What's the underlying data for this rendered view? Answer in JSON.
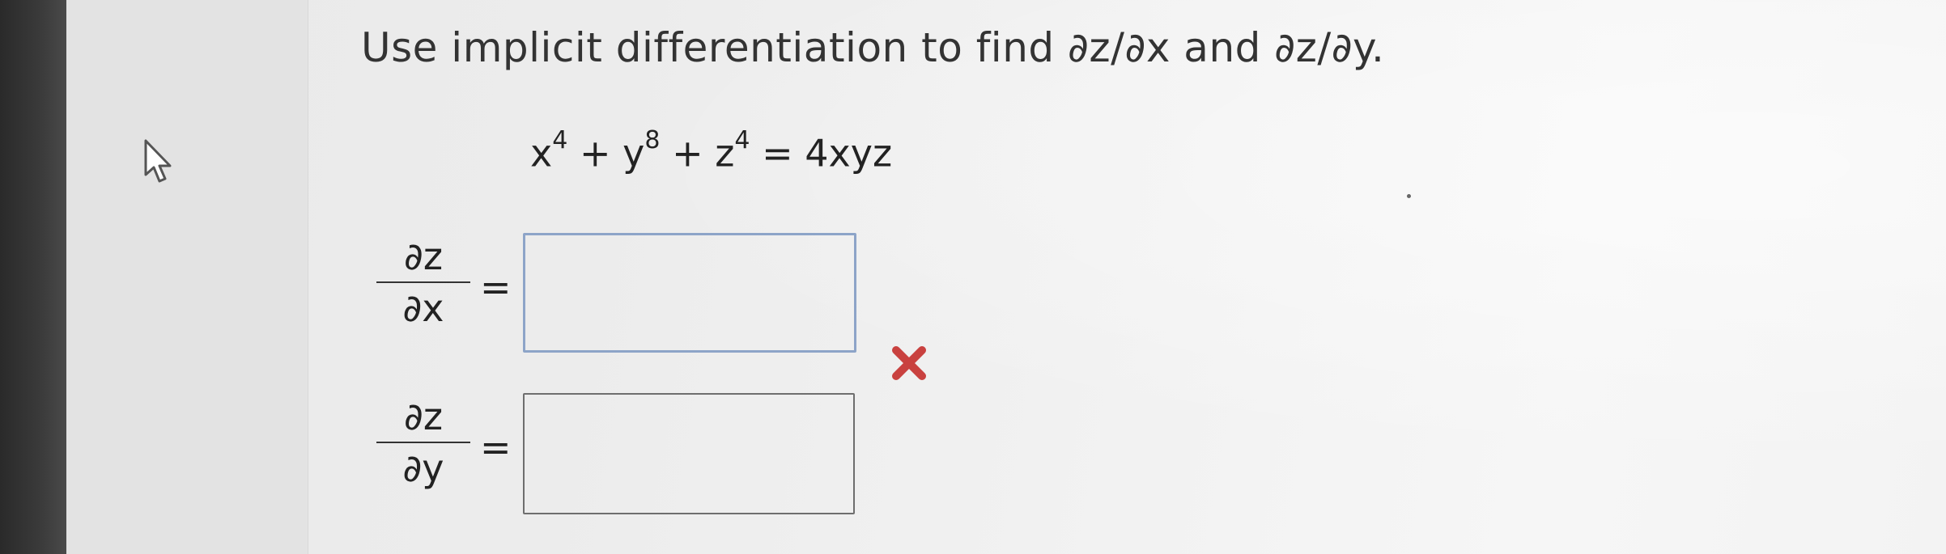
{
  "question": {
    "text": "Use implicit differentiation to find ∂z/∂x and ∂z/∂y."
  },
  "equation": {
    "base1": "x",
    "exp1": "4",
    "plus1": " + ",
    "base2": "y",
    "exp2": "8",
    "plus2": " + ",
    "base3": "z",
    "exp3": "4",
    "rhs": " = 4xyz"
  },
  "answers": [
    {
      "numerator": "∂z",
      "denominator": "∂x",
      "equals": "=",
      "value": "",
      "status": "incorrect"
    },
    {
      "numerator": "∂z",
      "denominator": "∂y",
      "equals": "=",
      "value": "",
      "status": "unanswered"
    }
  ],
  "icons": {
    "cursor": "pointer-cursor-icon",
    "wrong": "red-x-icon"
  },
  "colors": {
    "wrong": "#c9413f",
    "active_box_border": "#8da4c8",
    "box_border": "#6e6e6e"
  }
}
